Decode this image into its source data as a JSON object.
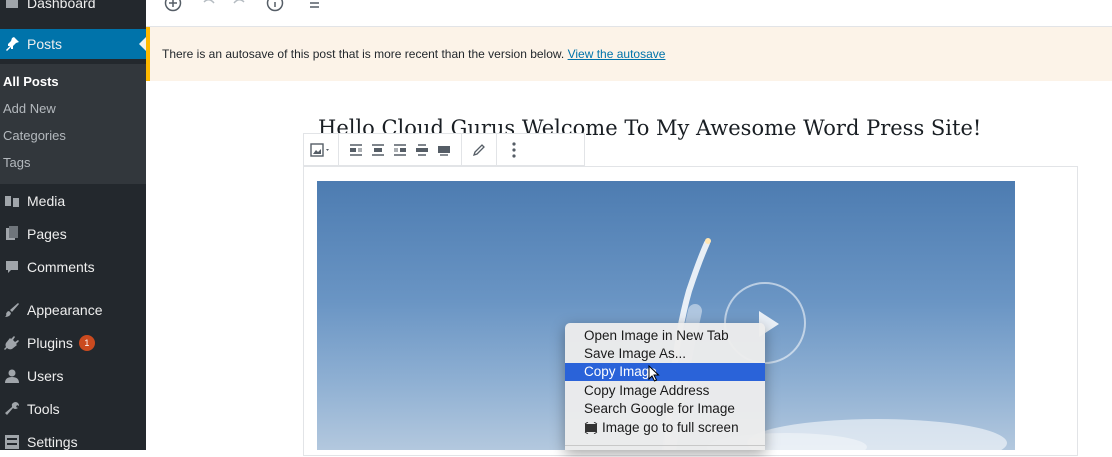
{
  "sidebar": {
    "dashboard_label": "Dashboard",
    "posts_label": "Posts",
    "submenu": [
      "All Posts",
      "Add New",
      "Categories",
      "Tags"
    ],
    "media_label": "Media",
    "pages_label": "Pages",
    "comments_label": "Comments",
    "appearance_label": "Appearance",
    "plugins_label": "Plugins",
    "plugins_badge": "1",
    "users_label": "Users",
    "tools_label": "Tools",
    "settings_label": "Settings"
  },
  "notice": {
    "text": "There is an autosave of this post that is more recent than the version below.",
    "link": "View the autosave"
  },
  "post": {
    "title": "Hello Cloud Gurus Welcome To My Awesome Word Press Site!"
  },
  "context_menu": {
    "items": [
      "Open Image in New Tab",
      "Save Image As...",
      "Copy Image",
      "Copy Image Address",
      "Search Google for Image",
      "Image go to full screen"
    ],
    "selected": "Copy Image"
  },
  "colors": {
    "sidebar_bg": "#23282d",
    "active_menu": "#0073aa",
    "notice_bg": "#fcf3e8",
    "notice_border": "#ffb900",
    "selection": "#2a63d9",
    "badge": "#ca4a1f"
  }
}
